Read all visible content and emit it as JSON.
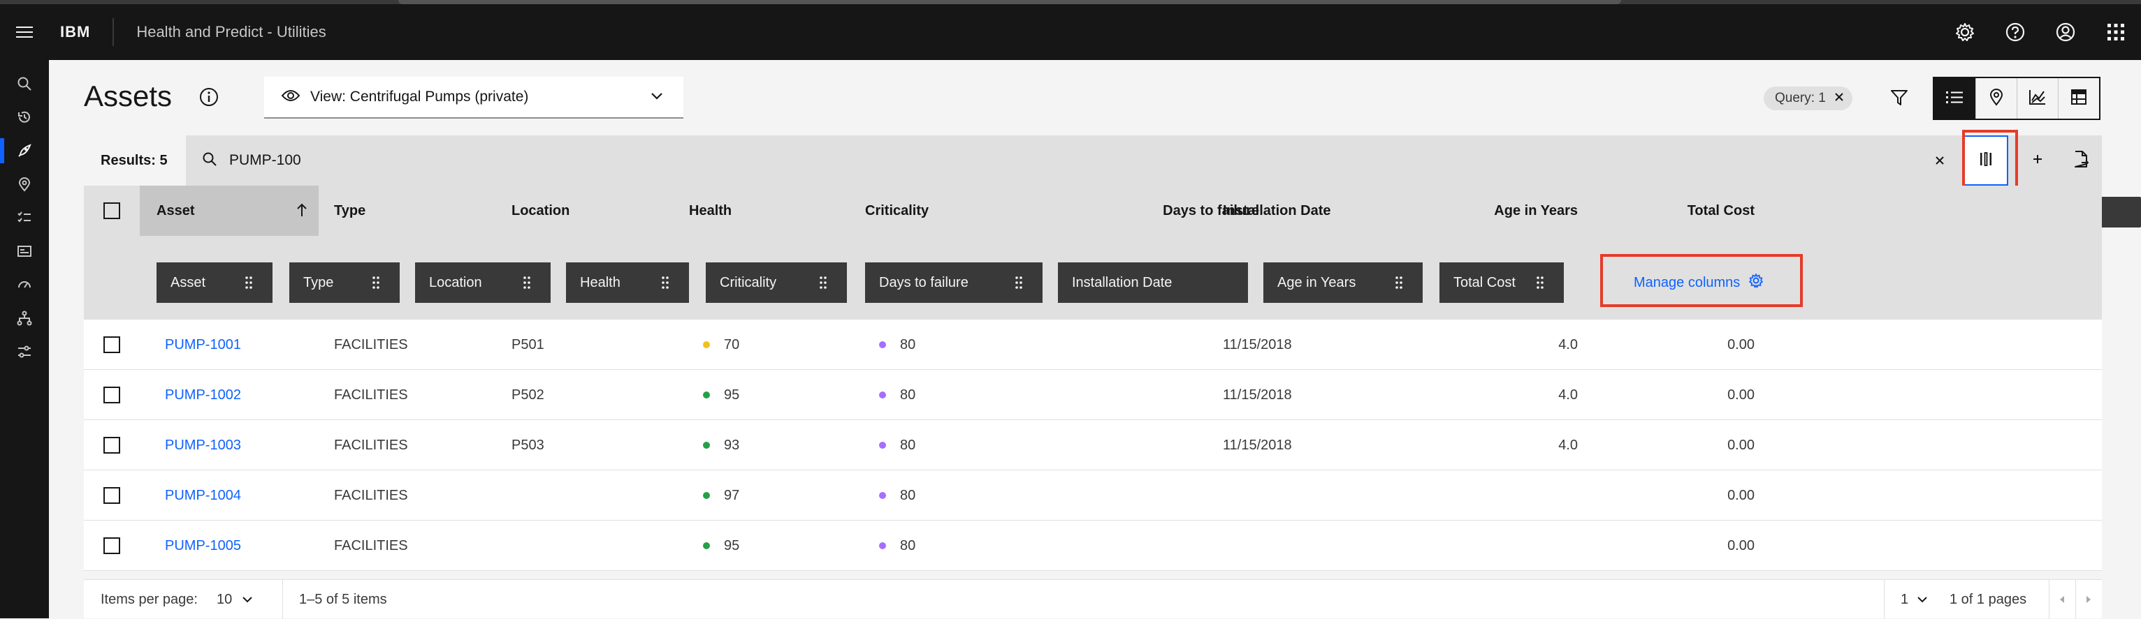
{
  "header": {
    "brand": "IBM",
    "product": "Health and Predict - Utilities",
    "actions": [
      "gear-icon",
      "help-icon",
      "user-avatar-icon",
      "app-switcher-icon"
    ]
  },
  "sidenav": {
    "items": [
      {
        "icon": "search-icon",
        "active": false
      },
      {
        "icon": "history-icon",
        "active": false
      },
      {
        "icon": "rocket-icon",
        "active": true
      },
      {
        "icon": "location-icon",
        "active": false
      },
      {
        "icon": "checklist-icon",
        "active": false
      },
      {
        "icon": "id-card-icon",
        "active": false
      },
      {
        "icon": "meter-icon",
        "active": false
      },
      {
        "icon": "hierarchy-icon",
        "active": false
      },
      {
        "icon": "settings-adjust-icon",
        "active": false
      }
    ]
  },
  "page": {
    "title": "Assets",
    "view_label": "View: Centrifugal Pumps (private)",
    "query_tag": "Query: 1"
  },
  "toolbar": {
    "results": "Results: 5",
    "search_value": "PUMP-100",
    "tooltip": "Manage columns"
  },
  "table": {
    "headers": {
      "asset": "Asset",
      "type": "Type",
      "location": "Location",
      "health": "Health",
      "criticality": "Criticality",
      "days": "Days to failure",
      "install": "Installation Date",
      "age": "Age in Years",
      "cost": "Total Cost"
    },
    "chips": [
      "Asset",
      "Type",
      "Location",
      "Health",
      "Criticality",
      "Days to failure",
      "Installation Date",
      "Age in Years",
      "Total Cost"
    ],
    "manage_columns": "Manage columns",
    "rows": [
      {
        "asset": "PUMP-1001",
        "type": "FACILITIES",
        "location": "P501",
        "health": "70",
        "health_color": "#f1c21b",
        "criticality": "80",
        "install": "11/15/2018",
        "age": "4.0",
        "cost": "0.00"
      },
      {
        "asset": "PUMP-1002",
        "type": "FACILITIES",
        "location": "P502",
        "health": "95",
        "health_color": "#24a148",
        "criticality": "80",
        "install": "11/15/2018",
        "age": "4.0",
        "cost": "0.00"
      },
      {
        "asset": "PUMP-1003",
        "type": "FACILITIES",
        "location": "P503",
        "health": "93",
        "health_color": "#24a148",
        "criticality": "80",
        "install": "11/15/2018",
        "age": "4.0",
        "cost": "0.00"
      },
      {
        "asset": "PUMP-1004",
        "type": "FACILITIES",
        "location": "",
        "health": "97",
        "health_color": "#24a148",
        "criticality": "80",
        "install": "",
        "age": "",
        "cost": "0.00"
      },
      {
        "asset": "PUMP-1005",
        "type": "FACILITIES",
        "location": "",
        "health": "95",
        "health_color": "#24a148",
        "criticality": "80",
        "install": "",
        "age": "",
        "cost": "0.00"
      }
    ],
    "criticality_color": "#a56eff"
  },
  "pagination": {
    "items_per_page_label": "Items per page:",
    "items_per_page": "10",
    "range": "1–5 of 5 items",
    "page": "1",
    "pages": "1 of 1 pages"
  },
  "colors": {
    "accent": "#0f62fe",
    "highlight": "#e53b2a"
  }
}
